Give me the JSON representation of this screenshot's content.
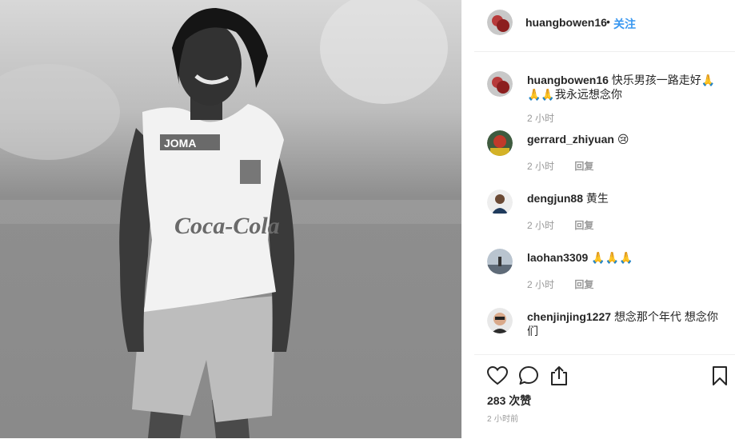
{
  "post": {
    "image_alt": "black-and-white photo of a smiling football player in a Coca-Cola jersey",
    "jersey_brand": "JOMA",
    "jersey_sponsor": "Coca-Cola"
  },
  "header": {
    "username": "huangbowen16",
    "separator": "•",
    "follow_label": "关注"
  },
  "comments": [
    {
      "username": "huangbowen16",
      "text": "快乐男孩一路走好🙏🙏🙏我永远想念你",
      "time": "2 小时",
      "reply": ""
    },
    {
      "username": "gerrard_zhiyuan",
      "text": "😢",
      "time": "2 小时",
      "reply": "回复"
    },
    {
      "username": "dengjun88",
      "text": "黄生",
      "time": "2 小时",
      "reply": "回复"
    },
    {
      "username": "laohan3309",
      "text": "🙏🙏🙏",
      "time": "2 小时",
      "reply": "回复"
    },
    {
      "username": "chenjinjing1227",
      "text": "想念那个年代 想念你们",
      "time": "",
      "reply": ""
    }
  ],
  "actions": {
    "likes": "283 次赞",
    "posted": "2 小时前",
    "icons": [
      "heart-icon",
      "comment-icon",
      "share-icon",
      "bookmark-icon"
    ]
  },
  "colors": {
    "link": "#3897f0",
    "text": "#262626",
    "muted": "#999999",
    "divider": "#efefef"
  }
}
